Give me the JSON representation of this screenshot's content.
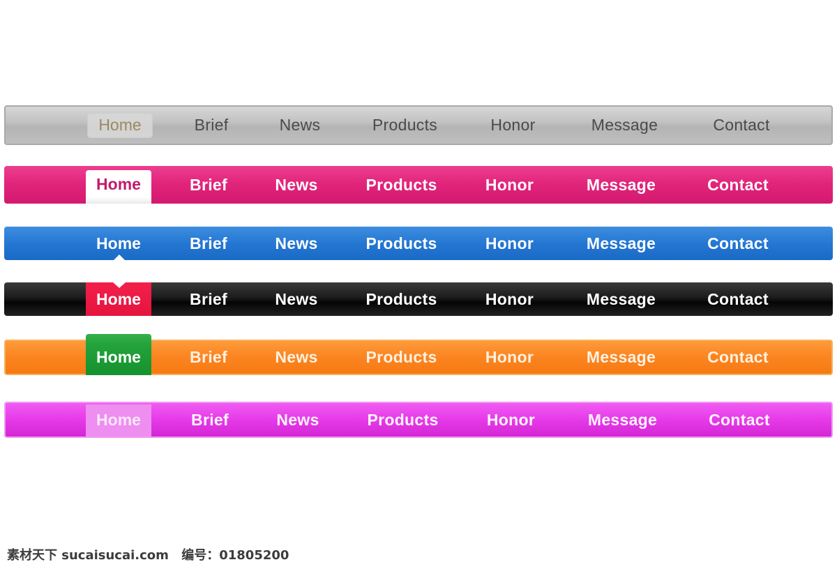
{
  "menus": [
    {
      "id": "gray",
      "items": [
        "Home",
        "Brief",
        "News",
        "Products",
        "Honor",
        "Message",
        "Contact"
      ]
    },
    {
      "id": "pink",
      "items": [
        "Home",
        "Brief",
        "News",
        "Products",
        "Honor",
        "Message",
        "Contact"
      ]
    },
    {
      "id": "blue",
      "items": [
        "Home",
        "Brief",
        "News",
        "Products",
        "Honor",
        "Message",
        "Contact"
      ]
    },
    {
      "id": "black",
      "items": [
        "Home",
        "Brief",
        "News",
        "Products",
        "Honor",
        "Message",
        "Contact"
      ]
    },
    {
      "id": "orange",
      "items": [
        "Home",
        "Brief",
        "News",
        "Products",
        "Honor",
        "Message",
        "Contact"
      ]
    },
    {
      "id": "magenta",
      "items": [
        "Home",
        "Brief",
        "News",
        "Products",
        "Honor",
        "Message",
        "Contact"
      ]
    }
  ],
  "active_item": "Home",
  "colors": {
    "gray": "#c3c3c3",
    "pink": "#e2257c",
    "blue": "#2477d2",
    "black": "#111111",
    "orange": "#fb8420",
    "magenta": "#e63ae8",
    "active_red": "#e5143e",
    "active_green": "#23a13b"
  },
  "footer": {
    "site": "素材天下 sucaisucai.com",
    "number": "编号：01805200"
  }
}
